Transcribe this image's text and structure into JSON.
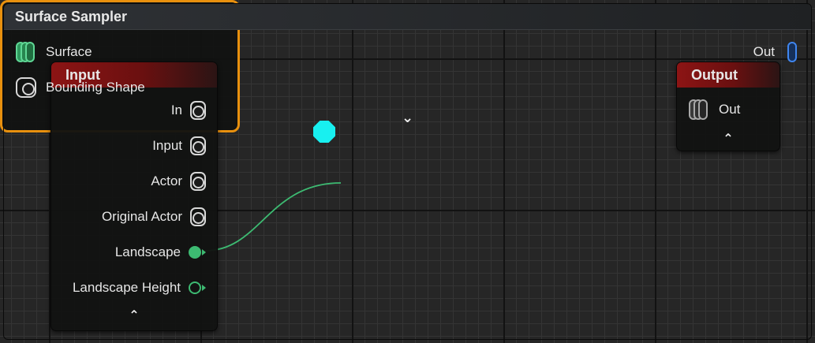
{
  "graph": {
    "nodes": {
      "input": {
        "title": "Input",
        "header_color": "#8c1414",
        "pins": [
          {
            "label": "In",
            "type": "port-white"
          },
          {
            "label": "Input",
            "type": "port-white"
          },
          {
            "label": "Actor",
            "type": "port-white"
          },
          {
            "label": "Original Actor",
            "type": "port-white"
          },
          {
            "label": "Landscape",
            "type": "port-green-connected"
          },
          {
            "label": "Landscape Height",
            "type": "port-green"
          }
        ],
        "collapse_glyph": "⌃"
      },
      "surface_sampler": {
        "title": "Surface Sampler",
        "selection_color": "#e8900e",
        "input_pins": [
          {
            "label": "Surface",
            "type": "stack-green-icon"
          },
          {
            "label": "Bounding Shape",
            "type": "port-white"
          }
        ],
        "output_pins": [
          {
            "label": "Out",
            "type": "stack-blue-icon"
          }
        ],
        "expand_glyph": "⌄"
      },
      "output": {
        "title": "Output",
        "header_color": "#8c1414",
        "pins": [
          {
            "label": "Out",
            "type": "stack-grey-icon"
          }
        ],
        "collapse_glyph": "⌃"
      }
    },
    "colors": {
      "wire_green": "#3dbb72",
      "exec_pin": "#18f0f0",
      "grid_bg": "#262626"
    }
  }
}
